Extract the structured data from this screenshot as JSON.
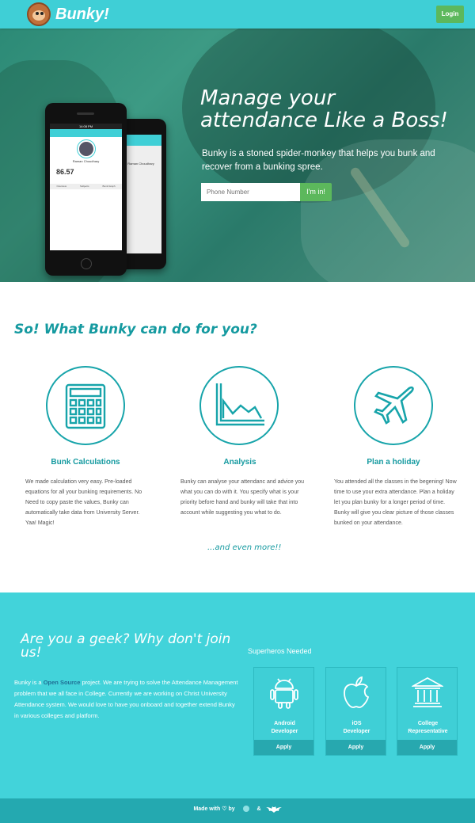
{
  "nav": {
    "brand": "Bunky!",
    "login_label": "Login"
  },
  "hero": {
    "title_line1": "Manage your",
    "title_line2": "attendance Like a Boss!",
    "subtitle": "Bunky is a stoned spider-monkey that helps you bunk and recover from a bunking spree.",
    "phone_placeholder": "Phone Number",
    "submit_label": "I'm in!",
    "phone_mock": {
      "time": "14:08 PM",
      "user_name": "Raman Choudhary",
      "score": "86.57",
      "tabs": [
        "Overview",
        "Subjects",
        "Bunk Graph"
      ]
    }
  },
  "features": {
    "title": "So! What Bunky can do for you?",
    "items": [
      {
        "heading": "Bunk Calculations",
        "icon": "calculator-icon",
        "text": "We made calculation very easy. Pre-loaded equations for all your bunking requirements. No Need to copy paste the values, Bunky can automatically take data from University Server. Yaa! Magic!"
      },
      {
        "heading": "Analysis",
        "icon": "chart-icon",
        "text": "Bunky can analyse your attendanc and advice you what you can do with it. You specify what is your priority before hand and bunky will take that into account while suggesting you what to do."
      },
      {
        "heading": "Plan a holiday",
        "icon": "airplane-icon",
        "text": "You attended all the classes in the begening! Now time to use your extra attendance. Plan a holiday let you plan bunky for a longer period of time. Bunky will give you clear picture of those classes bunked on your attendance."
      }
    ],
    "more": "...and even more!!"
  },
  "geek": {
    "title": "Are you a geek? Why don't join us!",
    "text_pre": "Bunky is a ",
    "link": "Open Source",
    "text_post": " project. We are trying to solve the Attendance Management problem that we all face in College. Currently we are working on Christ University Attendance system. We would love to have you onboard and together extend Bunky in various colleges and platform.",
    "roles_title": "Superheros Needed",
    "roles": [
      {
        "line1": "Android",
        "line2": "Developer",
        "apply": "Apply",
        "icon": "android-icon"
      },
      {
        "line1": "iOS",
        "line2": "Developer",
        "apply": "Apply",
        "icon": "apple-icon"
      },
      {
        "line1": "College",
        "line2": "Representative",
        "apply": "Apply",
        "icon": "college-icon"
      }
    ]
  },
  "footer": {
    "made_with": "Made with",
    "by": "by",
    "amp": "&"
  },
  "colors": {
    "primary": "#3fcfd6",
    "accent": "#159aa0",
    "button": "#5cb85c"
  }
}
